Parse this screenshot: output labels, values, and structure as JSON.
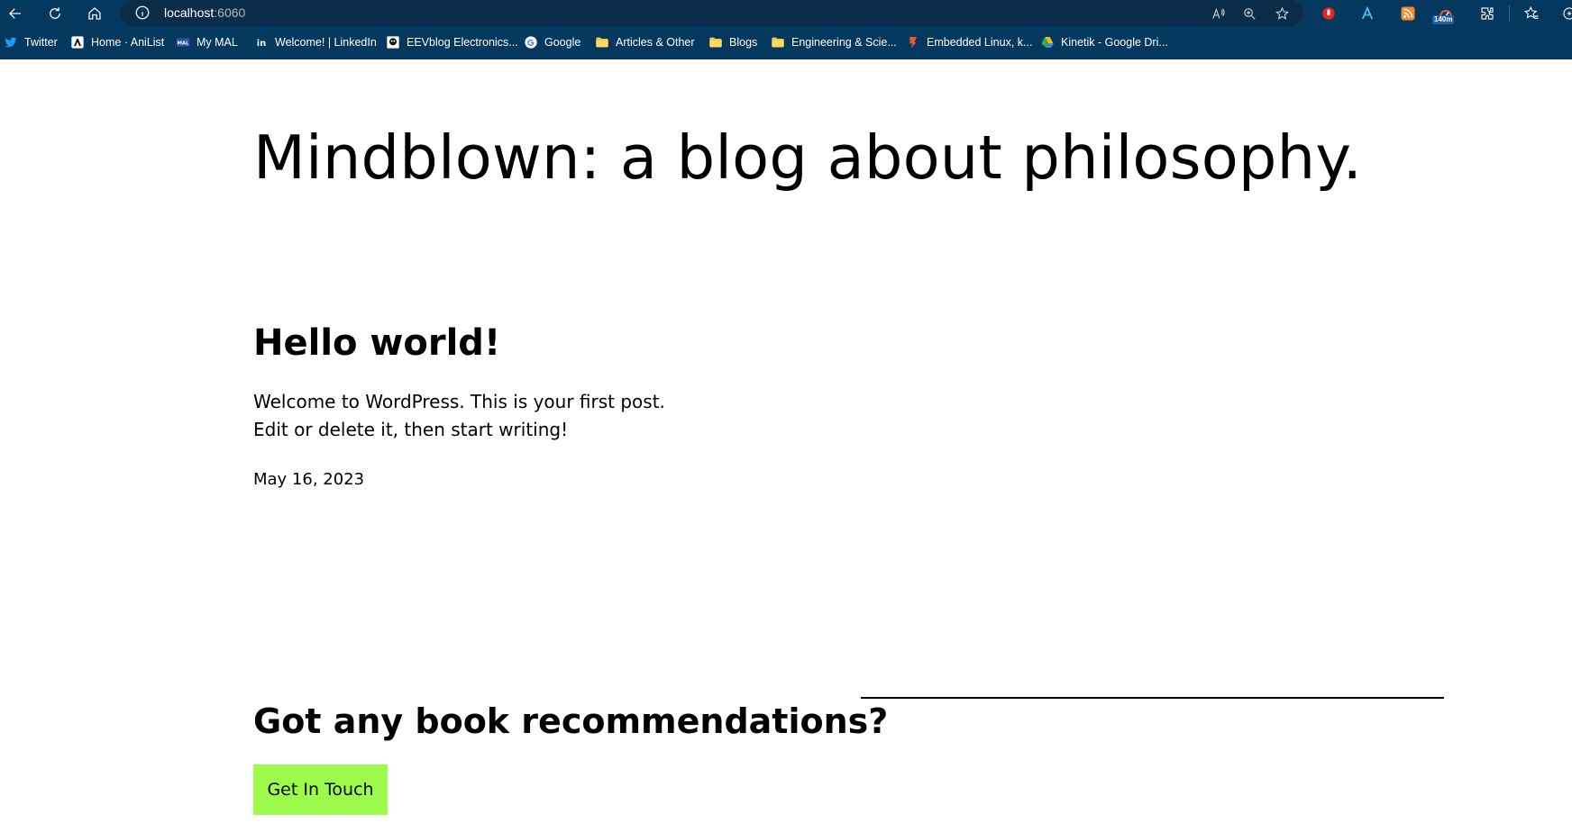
{
  "browser": {
    "url_host": "localhost",
    "url_port": ":6060",
    "extension_badge": "140m",
    "colors": {
      "chrome": "#05385f",
      "address_bar": "#0b2c49"
    },
    "toolbar_icons": [
      "back-arrow-icon",
      "refresh-icon",
      "home-icon"
    ],
    "bookmarks": [
      {
        "label": "Twitter",
        "icon": "twitter-icon"
      },
      {
        "label": "Home · AniList",
        "icon": "anilist-icon"
      },
      {
        "label": "My MAL",
        "icon": "mal-icon"
      },
      {
        "label": "Welcome! | LinkedIn",
        "icon": "linkedin-icon"
      },
      {
        "label": "EEVblog Electronics...",
        "icon": "eevblog-icon"
      },
      {
        "label": "Google",
        "icon": "google-icon"
      },
      {
        "label": "Articles & Other",
        "icon": "folder-icon"
      },
      {
        "label": "Blogs",
        "icon": "folder-icon"
      },
      {
        "label": "Engineering & Scie...",
        "icon": "folder-icon"
      },
      {
        "label": "Embedded Linux, k...",
        "icon": "embedded-linux-icon"
      },
      {
        "label": "Kinetik - Google Dri...",
        "icon": "google-drive-icon"
      }
    ]
  },
  "site": {
    "title": "Mindblown: a blog about philosophy."
  },
  "post": {
    "title": "Hello world!",
    "body_line1": "Welcome to WordPress. This is your first post.",
    "body_line2": "Edit or delete it, then start writing!",
    "date": "May 16, 2023"
  },
  "cta": {
    "heading": "Got any book recommendations?",
    "button_label": "Get In Touch",
    "button_color": "#9dfb4b"
  }
}
